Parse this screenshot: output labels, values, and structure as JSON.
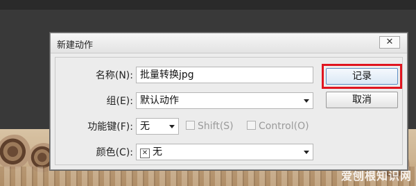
{
  "dialog": {
    "title": "新建动作",
    "close_icon": "close-icon"
  },
  "form": {
    "name_label": "名称(N):",
    "name_value": "批量转换jpg",
    "group_label": "组(E):",
    "group_value": "默认动作",
    "function_key_label": "功能键(F):",
    "function_key_value": "无",
    "shift_label": "Shift(S)",
    "control_label": "Control(O)",
    "color_label": "颜色(C):",
    "color_value": "无",
    "color_icon": "no-color-x-icon"
  },
  "buttons": {
    "record": "记录",
    "cancel": "取消"
  },
  "watermark": {
    "text": "爱刨根知识网"
  },
  "colors": {
    "highlight": "#e0151f",
    "dialog_bg": "#ececec"
  }
}
